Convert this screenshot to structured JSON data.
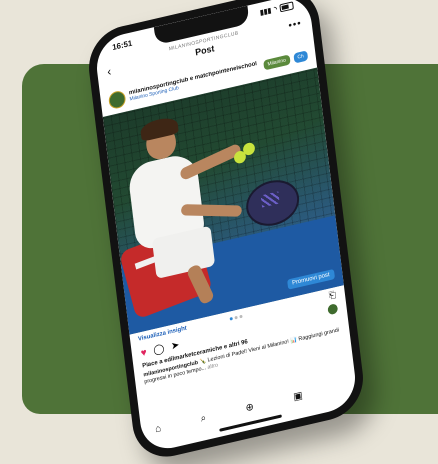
{
  "status": {
    "time": "16:51",
    "signal": "▮▮▮",
    "wifi": "◝"
  },
  "header": {
    "account": "MILANINOSPORTINGCLUB",
    "title": "Post",
    "back_icon": "‹",
    "more_icon": "•••"
  },
  "post": {
    "author": "milaninosportingclub e matchpointenelschool",
    "location": "Milanino Sporting Club",
    "chip_green": "Milanino",
    "chip_blue": "Ch",
    "promote_label": "Promuovi post",
    "insights_label": "Visualizza insight",
    "likes": "Piace a edilmarketceramiche e altri 96",
    "caption_user": "milaninosportingclub",
    "caption_text": "🍾 Lezioni di Padel! Vieni al Milanino! 📊 Raggiungi grandi progressi in poco tempo...",
    "caption_more": "altro"
  },
  "icons": {
    "heart": "♥",
    "comment": "◯",
    "share": "➤",
    "bookmark": "⎗",
    "home": "⌂",
    "search": "⌕",
    "add": "⊕",
    "reels": "▣"
  },
  "colors": {
    "background_green": "#4f7338",
    "accent_blue": "#2e88d6",
    "like_red": "#e0245e"
  }
}
